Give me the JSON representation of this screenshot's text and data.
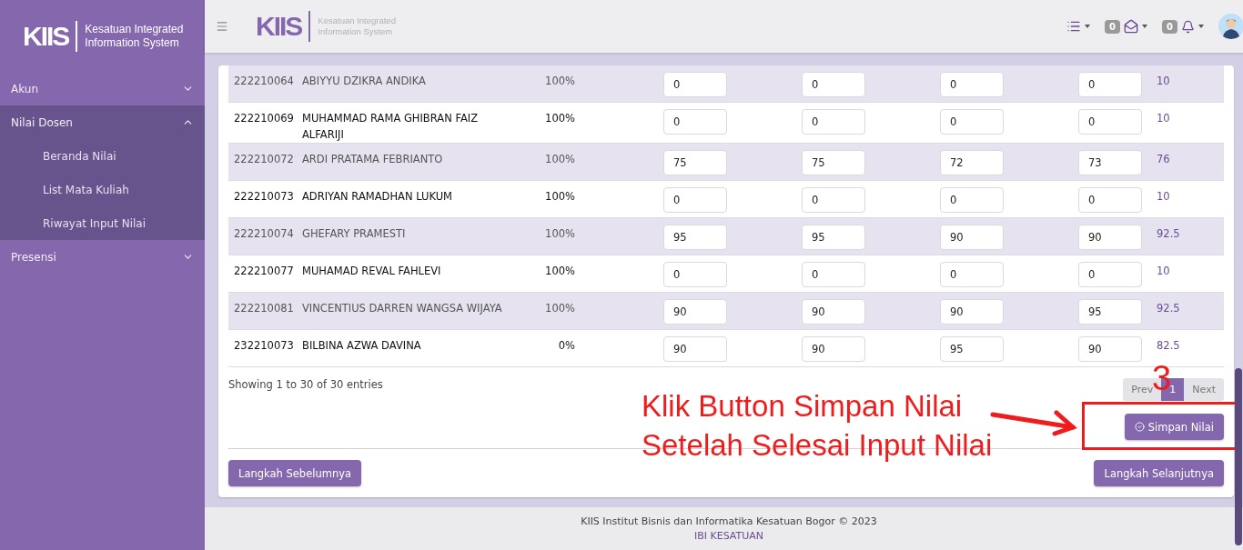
{
  "sidebar": {
    "logo": "KIIS",
    "logo_text": [
      "Kesatuan Integrated",
      "Information System"
    ],
    "items": [
      {
        "label": "Akun",
        "expanded": false
      },
      {
        "label": "Nilai Dosen",
        "expanded": true,
        "children": [
          {
            "label": "Beranda Nilai"
          },
          {
            "label": "List Mata Kuliah"
          },
          {
            "label": "Riwayat Input Nilai"
          }
        ]
      },
      {
        "label": "Presensi",
        "expanded": false
      }
    ]
  },
  "header": {
    "logo": "KIIS",
    "logo_text": [
      "Kesatuan Integrated",
      "Information System"
    ],
    "messages_badge": "0",
    "notifications_badge": "0"
  },
  "table": {
    "rows": [
      {
        "nim": "222210064",
        "name": "ABIYYU DZIKRA ANDIKA",
        "attendance": "100%",
        "scores": [
          "0",
          "0",
          "0",
          "0"
        ],
        "final": "10"
      },
      {
        "nim": "222210069",
        "name": "MUHAMMAD RAMA GHIBRAN FAIZ ALFARIJI",
        "attendance": "100%",
        "scores": [
          "0",
          "0",
          "0",
          "0"
        ],
        "final": "10"
      },
      {
        "nim": "222210072",
        "name": "ARDI PRATAMA FEBRIANTO",
        "attendance": "100%",
        "scores": [
          "75",
          "75",
          "72",
          "73"
        ],
        "final": "76"
      },
      {
        "nim": "222210073",
        "name": "ADRIYAN RAMADHAN LUKUM",
        "attendance": "100%",
        "scores": [
          "0",
          "0",
          "0",
          "0"
        ],
        "final": "10"
      },
      {
        "nim": "222210074",
        "name": "GHEFARY PRAMESTI",
        "attendance": "100%",
        "scores": [
          "95",
          "95",
          "90",
          "90"
        ],
        "final": "92.5"
      },
      {
        "nim": "222210077",
        "name": "MUHAMAD REVAL FAHLEVI",
        "attendance": "100%",
        "scores": [
          "0",
          "0",
          "0",
          "0"
        ],
        "final": "10"
      },
      {
        "nim": "222210081",
        "name": "VINCENTIUS DARREN WANGSA WIJAYA",
        "attendance": "100%",
        "scores": [
          "90",
          "90",
          "90",
          "95"
        ],
        "final": "92.5"
      },
      {
        "nim": "232210073",
        "name": "BILBINA AZWA DAVINA",
        "attendance": "0%",
        "scores": [
          "90",
          "90",
          "95",
          "90"
        ],
        "final": "82.5"
      }
    ]
  },
  "info": "Showing 1 to 30 of 30 entries",
  "pagination": {
    "prev": "Prev",
    "pages": [
      {
        "label": "1",
        "selected": true
      }
    ],
    "next": "Next"
  },
  "save_button": "Simpan Nilai",
  "prev_step_button": "Langkah Sebelumnya",
  "next_step_button": "Langkah Selanjutnya",
  "annotation": {
    "step": "3",
    "lines": [
      "Klik Button Simpan Nilai",
      "Setelah Selesai Input Nilai"
    ]
  },
  "footer": [
    "KIIS Institut Bisnis dan Informatika Kesatuan Bogor © 2023",
    "IBI KESATUAN"
  ]
}
